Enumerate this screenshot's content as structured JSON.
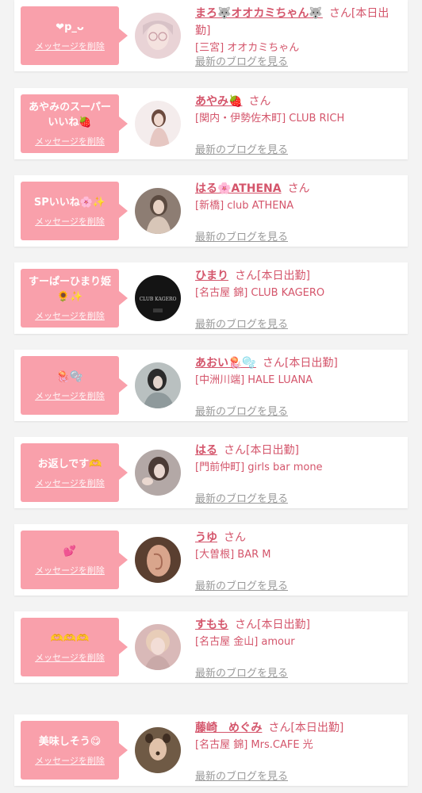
{
  "items": [
    {
      "message": "❤︎p_ᴗ",
      "delete_label": "メッセージを削除",
      "name": "まろ🐺オオカミちゃん🐺",
      "san": "さん",
      "status": "[本日出勤]",
      "shop": "[三宮] オオカミちゃん",
      "blog": "最新のブログを見る",
      "avatar_color": "#e9d3d6"
    },
    {
      "message": "あやみのスーパーいいね🍓",
      "delete_label": "メッセージを削除",
      "name": "あやみ🍓",
      "san": "さん",
      "status": "",
      "shop": "[関内・伊勢佐木町] CLUB RICH",
      "blog": "最新のブログを見る",
      "avatar_color": "#e2c8c4"
    },
    {
      "message": "SPいいね🌸✨",
      "delete_label": "メッセージを削除",
      "name": "はる🌸ATHENA",
      "san": "さん",
      "status": "",
      "shop": "[新橋] club ATHENA",
      "blog": "最新のブログを見る",
      "avatar_color": "#8d7d73"
    },
    {
      "message": "すーぱーひまり姫🌻✨",
      "delete_label": "メッセージを削除",
      "name": "ひまり",
      "san": "さん",
      "status": "[本日出勤]",
      "shop": "[名古屋 錦] CLUB KAGERO",
      "blog": "最新のブログを見る",
      "avatar_color": "#141414",
      "avatar_text": "CLUB KAGERO"
    },
    {
      "message": "🪼🫧",
      "delete_label": "メッセージを削除",
      "name": "あおい🪼🫧",
      "san": "さん",
      "status": "[本日出勤]",
      "shop": "[中洲川端] HALE LUANA",
      "blog": "最新のブログを見る",
      "avatar_color": "#9aa3a4"
    },
    {
      "message": "お返しです🫶",
      "delete_label": "メッセージを削除",
      "name": "はる",
      "san": "さん",
      "status": "[本日出勤]",
      "shop": "[門前仲町] girls bar mone",
      "blog": "最新のブログを見る",
      "avatar_color": "#a89a97"
    },
    {
      "message": "💕",
      "delete_label": "メッセージを削除",
      "name": "うゆ",
      "san": "さん",
      "status": "",
      "shop": "[大曽根] BAR M",
      "blog": "最新のブログを見る",
      "avatar_color": "#8a6a55"
    },
    {
      "message": "🫶🫶🫶",
      "delete_label": "メッセージを削除",
      "name": "すもも",
      "san": "さん",
      "status": "[本日出勤]",
      "shop": "[名古屋 金山] amour",
      "blog": "最新のブログを見る",
      "avatar_color": "#d9b9b8"
    },
    {
      "message": "美味しそう😋",
      "delete_label": "メッセージを削除",
      "name": "藤崎　めぐみ",
      "san": "さん",
      "status": "[本日出勤]",
      "shop": "[名古屋 錦] Mrs.CAFE 光",
      "blog": "最新のブログを見る",
      "avatar_color": "#6f5a45"
    }
  ]
}
